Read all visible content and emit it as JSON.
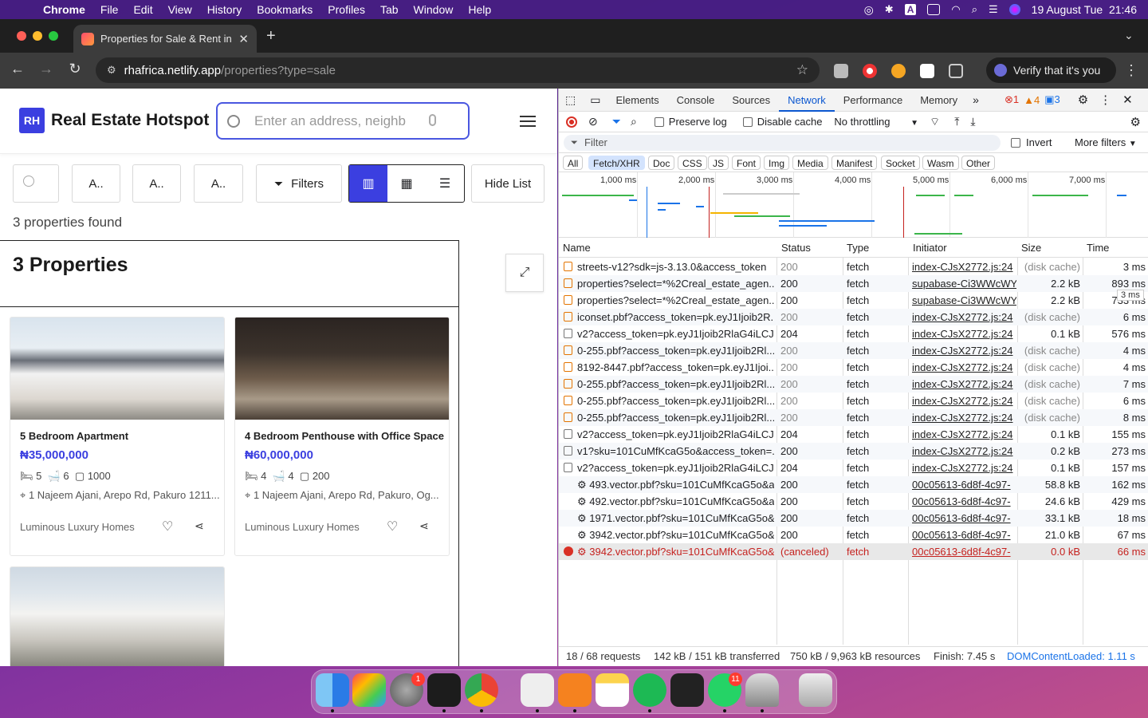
{
  "menubar": {
    "app": "Chrome",
    "items": [
      "File",
      "Edit",
      "View",
      "History",
      "Bookmarks",
      "Profiles",
      "Tab",
      "Window",
      "Help"
    ],
    "datetime": "19 August Tue  21:46"
  },
  "browser": {
    "tab_title": "Properties for Sale & Rent in",
    "url_host": "rhafrica.netlify.app",
    "url_path": "/properties?type=sale",
    "verify_label": "Verify that it's you"
  },
  "site": {
    "logo": "RH",
    "brand": "Real Estate Hotspot",
    "search_placeholder": "Enter an address, neighb",
    "filter_a1": "A..",
    "filter_a2": "A..",
    "filter_a3": "A..",
    "filters_label": "Filters",
    "hide_list_label": "Hide List",
    "found_text": "3 properties found",
    "list_title": "3 Properties",
    "cards": [
      {
        "title": "5 Bedroom Apartment",
        "price": "₦35,000,000",
        "beds": "5",
        "baths": "6",
        "area": "1000",
        "address": "1 Najeem Ajani, Arepo Rd, Pakuro 1211...",
        "agency": "Luminous Luxury Homes"
      },
      {
        "title": "4 Bedroom Penthouse with Office Space",
        "price": "₦60,000,000",
        "beds": "4",
        "baths": "4",
        "area": "200",
        "address": "1 Najeem Ajani, Arepo Rd, Pakuro, Og...",
        "agency": "Luminous Luxury Homes"
      }
    ]
  },
  "devtools": {
    "tabs": [
      "Elements",
      "Console",
      "Sources",
      "Network",
      "Performance",
      "Memory"
    ],
    "active_tab": "Network",
    "errors": "1",
    "warnings": "4",
    "messages": "3",
    "preserve_log": "Preserve log",
    "disable_cache": "Disable cache",
    "throttling": "No throttling",
    "filter_placeholder": "Filter",
    "invert": "Invert",
    "more_filters": "More filters",
    "type_filters": [
      "All",
      "Fetch/XHR",
      "Doc",
      "CSS",
      "JS",
      "Font",
      "Img",
      "Media",
      "Manifest",
      "Socket",
      "Wasm",
      "Other"
    ],
    "active_type": "Fetch/XHR",
    "timeline_ticks": [
      "1,000 ms",
      "2,000 ms",
      "3,000 ms",
      "4,000 ms",
      "5,000 ms",
      "6,000 ms",
      "7,000 ms"
    ],
    "columns": [
      "Name",
      "Status",
      "Type",
      "Initiator",
      "Size",
      "Time"
    ],
    "tooltip": "3 ms",
    "requests": [
      {
        "name": "streets-v12?sdk=js-3.13.0&access_token",
        "status": "200",
        "type": "fetch",
        "initiator": "index-CJsX2772.js:24",
        "size": "(disk cache)",
        "time": "3 ms",
        "icon": "xhr"
      },
      {
        "name": "properties?select=*%2Creal_estate_agen...",
        "status": "200",
        "type": "fetch",
        "initiator": "supabase-Ci3WWcWY.js",
        "size": "2.2 kB",
        "time": "893 ms",
        "icon": "xhr"
      },
      {
        "name": "properties?select=*%2Creal_estate_agen...",
        "status": "200",
        "type": "fetch",
        "initiator": "supabase-Ci3WWcWY.js",
        "size": "2.2 kB",
        "time": "733 ms",
        "icon": "xhr"
      },
      {
        "name": "iconset.pbf?access_token=pk.eyJ1Ijoib2R...",
        "status": "200",
        "type": "fetch",
        "initiator": "index-CJsX2772.js:24",
        "size": "(disk cache)",
        "time": "6 ms",
        "icon": "xhr"
      },
      {
        "name": "v2?access_token=pk.eyJ1Ijoib2RlaG4iLCJ...",
        "status": "204",
        "type": "fetch",
        "initiator": "index-CJsX2772.js:24",
        "size": "0.1 kB",
        "time": "576 ms",
        "icon": "doc"
      },
      {
        "name": "0-255.pbf?access_token=pk.eyJ1Ijoib2Rl...",
        "status": "200",
        "type": "fetch",
        "initiator": "index-CJsX2772.js:24",
        "size": "(disk cache)",
        "time": "4 ms",
        "icon": "xhr"
      },
      {
        "name": "8192-8447.pbf?access_token=pk.eyJ1Ijoi...",
        "status": "200",
        "type": "fetch",
        "initiator": "index-CJsX2772.js:24",
        "size": "(disk cache)",
        "time": "4 ms",
        "icon": "xhr"
      },
      {
        "name": "0-255.pbf?access_token=pk.eyJ1Ijoib2Rl...",
        "status": "200",
        "type": "fetch",
        "initiator": "index-CJsX2772.js:24",
        "size": "(disk cache)",
        "time": "7 ms",
        "icon": "xhr"
      },
      {
        "name": "0-255.pbf?access_token=pk.eyJ1Ijoib2Rl...",
        "status": "200",
        "type": "fetch",
        "initiator": "index-CJsX2772.js:24",
        "size": "(disk cache)",
        "time": "6 ms",
        "icon": "xhr"
      },
      {
        "name": "0-255.pbf?access_token=pk.eyJ1Ijoib2Rl...",
        "status": "200",
        "type": "fetch",
        "initiator": "index-CJsX2772.js:24",
        "size": "(disk cache)",
        "time": "8 ms",
        "icon": "xhr"
      },
      {
        "name": "v2?access_token=pk.eyJ1Ijoib2RlaG4iLCJ...",
        "status": "204",
        "type": "fetch",
        "initiator": "index-CJsX2772.js:24",
        "size": "0.1 kB",
        "time": "155 ms",
        "icon": "doc"
      },
      {
        "name": "v1?sku=101CuMfKcaG5o&access_token=...",
        "status": "200",
        "type": "fetch",
        "initiator": "index-CJsX2772.js:24",
        "size": "0.2 kB",
        "time": "273 ms",
        "icon": "doc"
      },
      {
        "name": "v2?access_token=pk.eyJ1Ijoib2RlaG4iLCJ...",
        "status": "204",
        "type": "fetch",
        "initiator": "index-CJsX2772.js:24",
        "size": "0.1 kB",
        "time": "157 ms",
        "icon": "doc"
      },
      {
        "name": "⚙ 493.vector.pbf?sku=101CuMfKcaG5o&a...",
        "status": "200",
        "type": "fetch",
        "initiator": "00c05613-6d8f-4c97-",
        "size": "58.8 kB",
        "time": "162 ms",
        "icon": "none"
      },
      {
        "name": "⚙ 492.vector.pbf?sku=101CuMfKcaG5o&a...",
        "status": "200",
        "type": "fetch",
        "initiator": "00c05613-6d8f-4c97-",
        "size": "24.6 kB",
        "time": "429 ms",
        "icon": "none"
      },
      {
        "name": "⚙ 1971.vector.pbf?sku=101CuMfKcaG5o&...",
        "status": "200",
        "type": "fetch",
        "initiator": "00c05613-6d8f-4c97-",
        "size": "33.1 kB",
        "time": "18 ms",
        "icon": "none"
      },
      {
        "name": "⚙ 3942.vector.pbf?sku=101CuMfKcaG5o&...",
        "status": "200",
        "type": "fetch",
        "initiator": "00c05613-6d8f-4c97-",
        "size": "21.0 kB",
        "time": "67 ms",
        "icon": "none"
      },
      {
        "name": "⚙ 3942.vector.pbf?sku=101CuMfKcaG5o&...",
        "status": "(canceled)",
        "type": "fetch",
        "initiator": "00c05613-6d8f-4c97-",
        "size": "0.0 kB",
        "time": "66 ms",
        "icon": "err"
      }
    ],
    "summary": {
      "requests": "18 / 68 requests",
      "transferred": "142 kB / 151 kB transferred",
      "resources": "750 kB / 9,963 kB resources",
      "finish": "Finish: 7.45 s",
      "domcontentloaded": "DOMContentLoaded: 1.11 s"
    }
  },
  "dock": {
    "settings_badge": "1",
    "whatsapp_badge": "11"
  }
}
